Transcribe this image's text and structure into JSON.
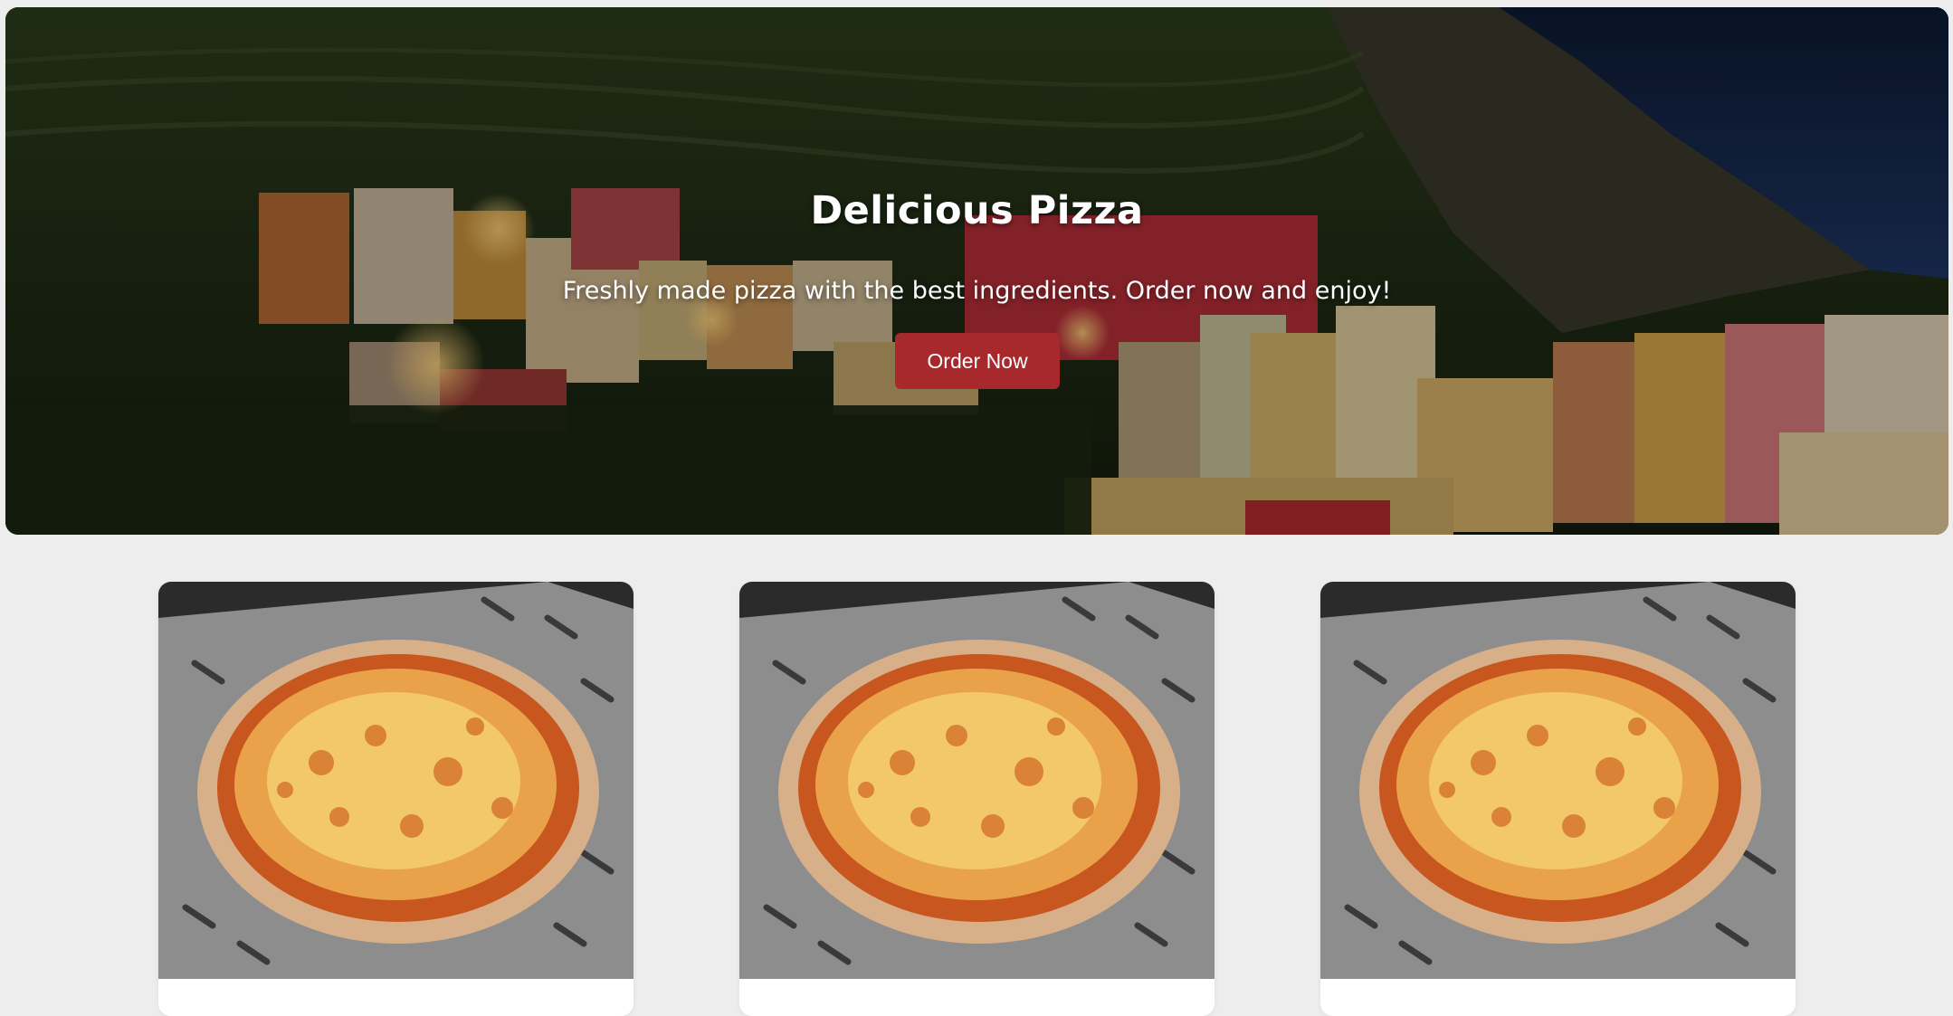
{
  "hero": {
    "title": "Delicious Pizza",
    "subtitle": "Freshly made pizza with the best ingredients. Order now and enjoy!",
    "cta_label": "Order Now",
    "background": "coastal-village-hillside-photo"
  },
  "cards": [
    {
      "image": "margherita-pizza-photo"
    },
    {
      "image": "margherita-pizza-photo"
    },
    {
      "image": "margherita-pizza-photo"
    }
  ],
  "colors": {
    "page_background": "#ededed",
    "button": "#a8292b",
    "button_text": "#ffffff",
    "hero_text": "#ffffff"
  }
}
